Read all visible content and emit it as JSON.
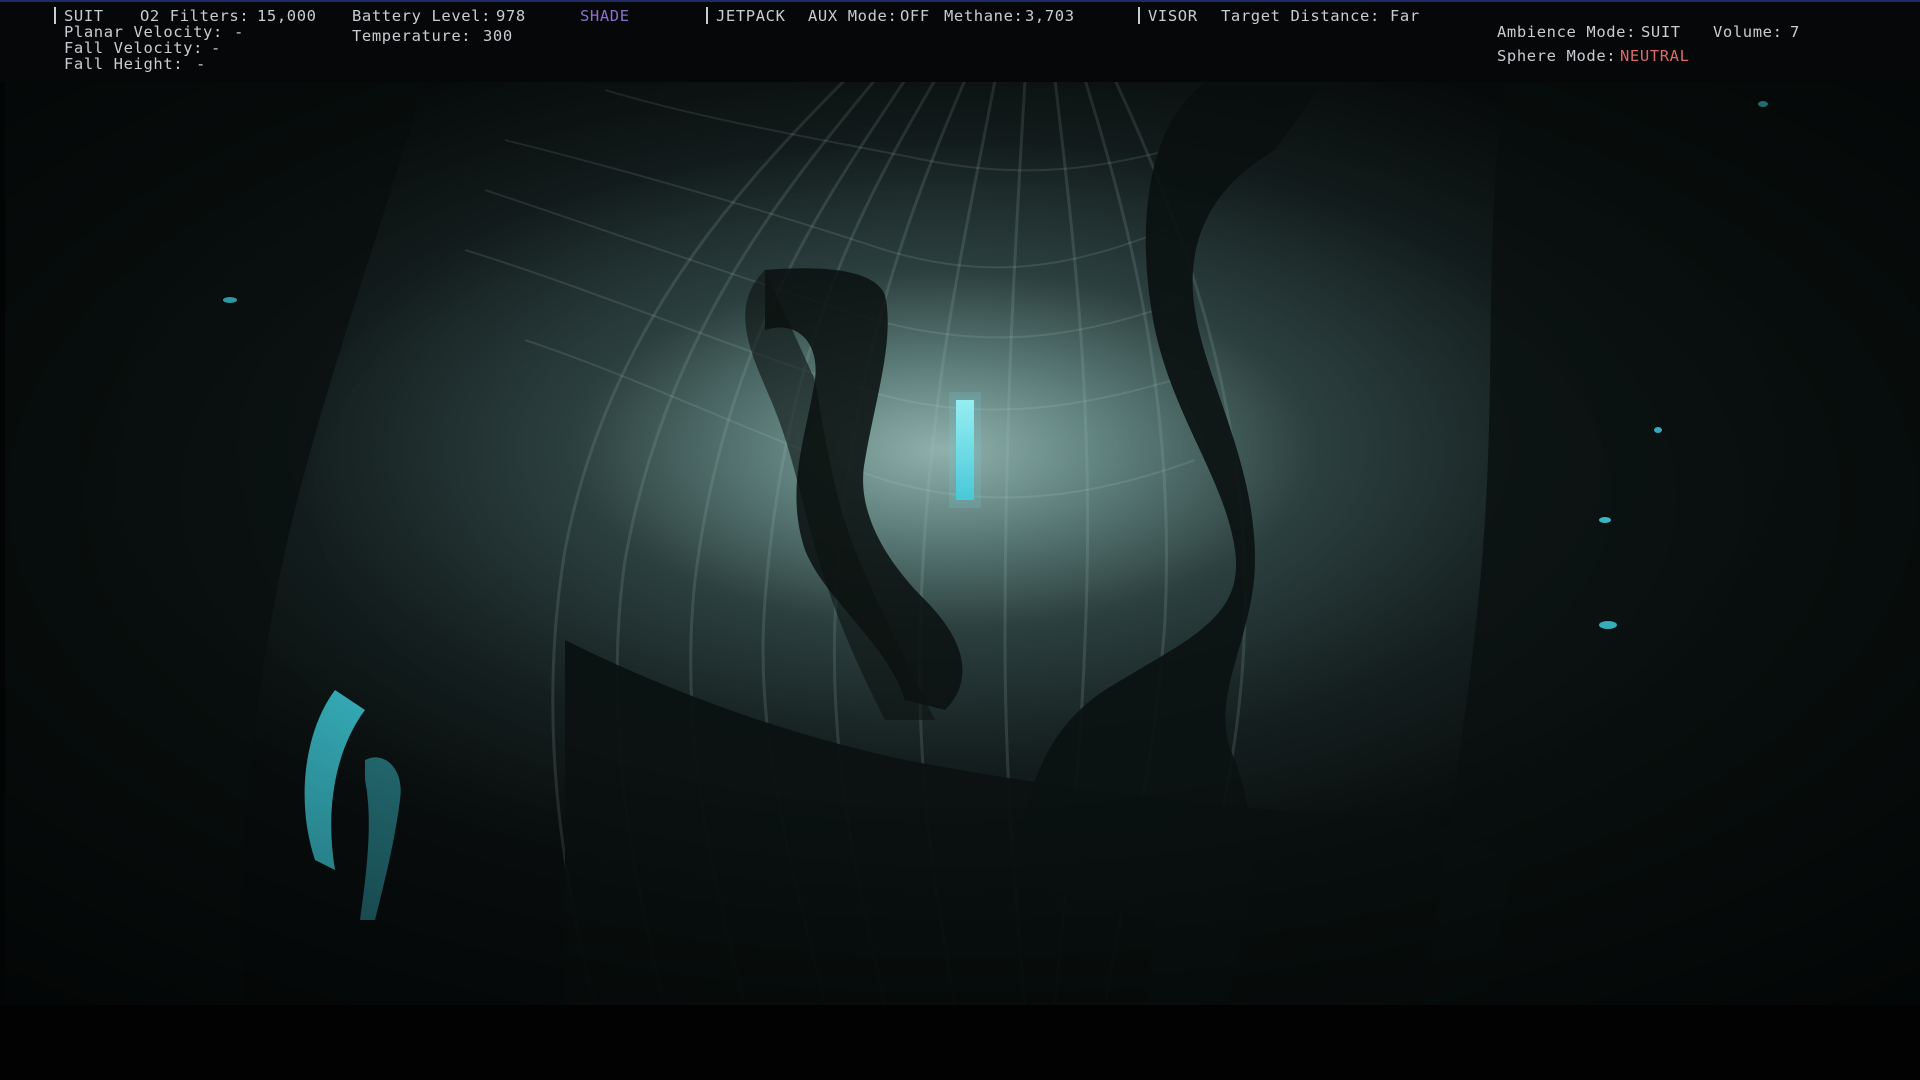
{
  "hud": {
    "suit": {
      "section_label": "SUIT",
      "o2_filters_label": "O2 Filters:",
      "o2_filters_value": "15,000",
      "planar_velocity_label": "Planar Velocity:",
      "planar_velocity_value": "-",
      "fall_velocity_label": "Fall Velocity:",
      "fall_velocity_value": "-",
      "fall_height_label": "Fall Height:",
      "fall_height_value": "-",
      "battery_label": "Battery Level:",
      "battery_value": "978",
      "temperature_label": "Temperature:",
      "temperature_value": "300",
      "shade_label": "SHADE"
    },
    "jetpack": {
      "section_label": "JETPACK",
      "aux_mode_label": "AUX Mode:",
      "aux_mode_value": "OFF",
      "methane_label": "Methane:",
      "methane_value": "3,703"
    },
    "visor": {
      "section_label": "VISOR",
      "target_distance_label": "Target Distance:",
      "target_distance_value": "Far"
    },
    "audio": {
      "ambience_label": "Ambience Mode:",
      "ambience_value": "SUIT",
      "volume_label": "Volume:",
      "volume_value": "7",
      "sphere_label": "Sphere Mode:",
      "sphere_value": "NEUTRAL"
    }
  },
  "colors": {
    "hud_text": "#c9ccd0",
    "shade": "#8a6fd0",
    "neutral": "#d96a6a",
    "top_border": "#1f2a66",
    "glow": "#6fe6f0"
  }
}
